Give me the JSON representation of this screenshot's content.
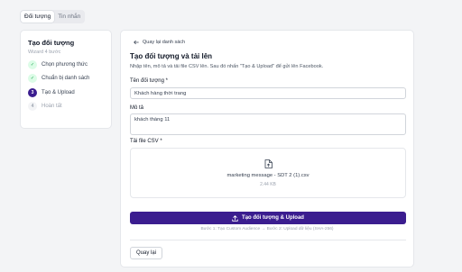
{
  "tabs": [
    {
      "label": "Đối tượng",
      "active": true
    },
    {
      "label": "Tin nhắn",
      "active": false
    }
  ],
  "wizard": {
    "title": "Tạo đối tượng",
    "subtitle": "Wizard 4 bước",
    "steps": [
      {
        "number": "✓",
        "label": "Chọn phương thức",
        "state": "done"
      },
      {
        "number": "✓",
        "label": "Chuẩn bị danh sách",
        "state": "done"
      },
      {
        "number": "3",
        "label": "Tạo & Upload",
        "state": "current"
      },
      {
        "number": "4",
        "label": "Hoàn tất",
        "state": "pending"
      }
    ]
  },
  "main": {
    "back_label": "Quay lại danh sách",
    "title": "Tạo đối tượng và tải lên",
    "description": "Nhập tên, mô tả và tải file CSV lên. Sau đó nhấn \"Tạo & Upload\" để gửi lên Facebook.",
    "name_label": "Tên đối tượng *",
    "name_value": "Khách hàng thời trang",
    "desc_label": "Mô tả",
    "desc_value": "khách thàng 11",
    "csv_label": "Tải file CSV *",
    "file_name": "marketing message - SDT 2 (1).csv",
    "file_size": "2.44 KB",
    "upload_button": "Tạo đối tượng & Upload",
    "hint": "Bước 1: Tạo Custom Audience → Bước 2: Upload dữ liệu (SHA-256)",
    "back_button": "Quay lại"
  },
  "colors": {
    "primary": "#3b1d8f",
    "done_green": "#16a34a"
  }
}
